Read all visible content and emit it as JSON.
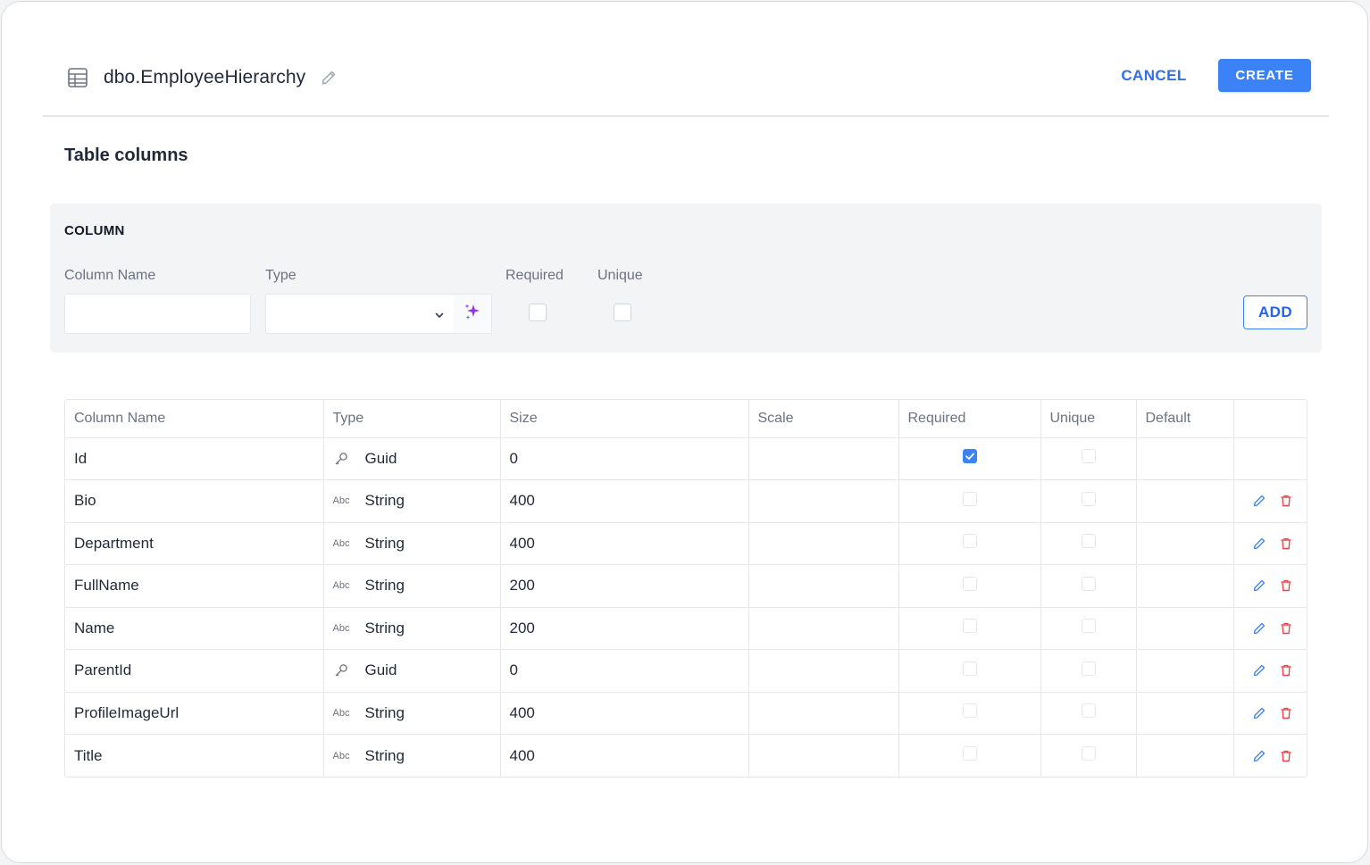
{
  "header": {
    "title": "dbo.EmployeeHierarchy",
    "cancel_label": "CANCEL",
    "create_label": "CREATE"
  },
  "section_title": "Table columns",
  "add_panel": {
    "heading": "COLUMN",
    "column_name_label": "Column Name",
    "column_name_value": "",
    "type_label": "Type",
    "type_value": "",
    "required_label": "Required",
    "required_checked": false,
    "unique_label": "Unique",
    "unique_checked": false,
    "add_label": "ADD"
  },
  "columns_table": {
    "headers": [
      "Column Name",
      "Type",
      "Size",
      "Scale",
      "Required",
      "Unique",
      "Default",
      ""
    ],
    "rows": [
      {
        "name": "Id",
        "type_icon": "key-icon",
        "type": "Guid",
        "size": "0",
        "scale": "",
        "required": true,
        "unique": false,
        "default": "",
        "editable": false
      },
      {
        "name": "Bio",
        "type_icon": "abc-icon",
        "type": "String",
        "size": "400",
        "scale": "",
        "required": false,
        "unique": false,
        "default": "",
        "editable": true
      },
      {
        "name": "Department",
        "type_icon": "abc-icon",
        "type": "String",
        "size": "400",
        "scale": "",
        "required": false,
        "unique": false,
        "default": "",
        "editable": true
      },
      {
        "name": "FullName",
        "type_icon": "abc-icon",
        "type": "String",
        "size": "200",
        "scale": "",
        "required": false,
        "unique": false,
        "default": "",
        "editable": true
      },
      {
        "name": "Name",
        "type_icon": "abc-icon",
        "type": "String",
        "size": "200",
        "scale": "",
        "required": false,
        "unique": false,
        "default": "",
        "editable": true
      },
      {
        "name": "ParentId",
        "type_icon": "key-icon",
        "type": "Guid",
        "size": "0",
        "scale": "",
        "required": false,
        "unique": false,
        "default": "",
        "editable": true
      },
      {
        "name": "ProfileImageUrl",
        "type_icon": "abc-icon",
        "type": "String",
        "size": "400",
        "scale": "",
        "required": false,
        "unique": false,
        "default": "",
        "editable": true
      },
      {
        "name": "Title",
        "type_icon": "abc-icon",
        "type": "String",
        "size": "400",
        "scale": "",
        "required": false,
        "unique": false,
        "default": "",
        "editable": true
      }
    ],
    "abc_glyph": "Abc"
  },
  "colors": {
    "accent": "#3b82f6",
    "accent_text": "#2f6fe8",
    "delete": "#ef4444",
    "magic": "#9333ea"
  }
}
